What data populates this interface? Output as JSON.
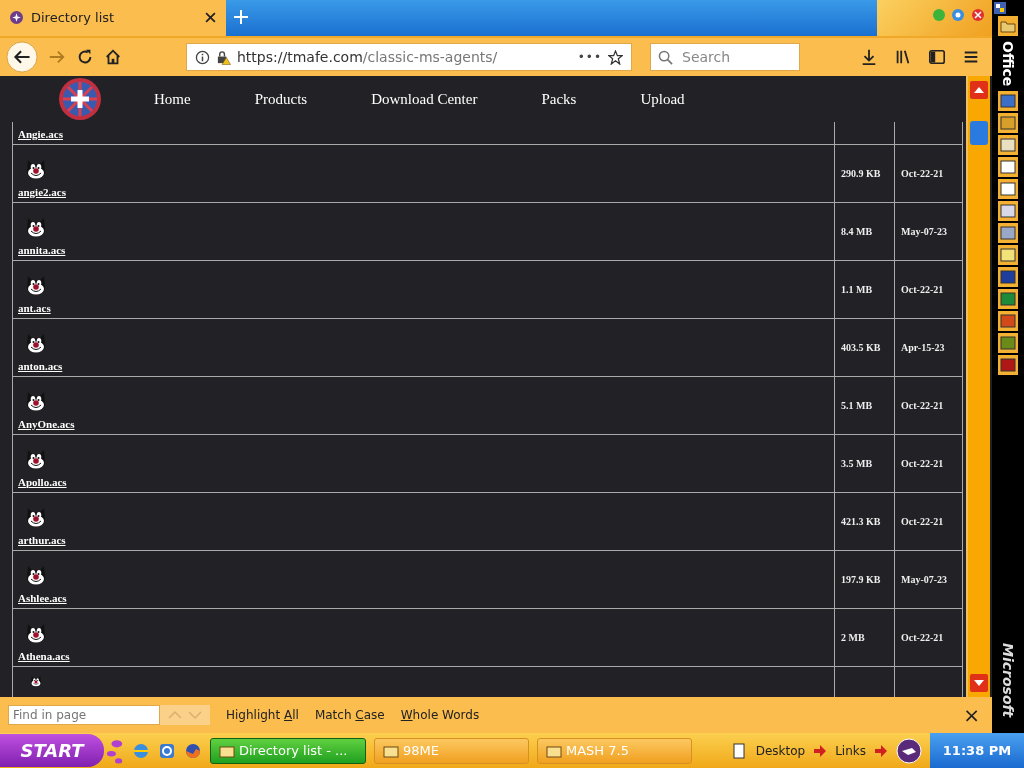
{
  "browser": {
    "tab": {
      "title": "Directory list"
    },
    "url_origin": "https://tmafe.com",
    "url_path": "/classic-ms-agents/",
    "more": "•••",
    "search_placeholder": "Search"
  },
  "site_nav": [
    "Home",
    "Products",
    "Download Center",
    "Packs",
    "Upload"
  ],
  "files": [
    {
      "name": "Angie.acs",
      "kind": "top-cut"
    },
    {
      "name": "angie2.acs",
      "size": "290.9 KB",
      "date": "Oct-22-21",
      "kind": "full"
    },
    {
      "name": "annita.acs",
      "size": "8.4 MB",
      "date": "May-07-23",
      "kind": "full"
    },
    {
      "name": "ant.acs",
      "size": "1.1 MB",
      "date": "Oct-22-21",
      "kind": "full"
    },
    {
      "name": "anton.acs",
      "size": "403.5 KB",
      "date": "Apr-15-23",
      "kind": "full"
    },
    {
      "name": "AnyOne.acs",
      "size": "5.1 MB",
      "date": "Oct-22-21",
      "kind": "full"
    },
    {
      "name": "Apollo.acs",
      "size": "3.5 MB",
      "date": "Oct-22-21",
      "kind": "full"
    },
    {
      "name": "arthur.acs",
      "size": "421.3 KB",
      "date": "Oct-22-21",
      "kind": "full"
    },
    {
      "name": "Ashlee.acs",
      "size": "197.9 KB",
      "date": "May-07-23",
      "kind": "full"
    },
    {
      "name": "Athena.acs",
      "size": "2 MB",
      "date": "Oct-22-21",
      "kind": "full"
    },
    {
      "kind": "bottom-cut"
    }
  ],
  "find_bar": {
    "placeholder": "Find in page",
    "options": [
      {
        "before": "Highlight ",
        "key": "A",
        "after": "ll"
      },
      {
        "before": "Match ",
        "key": "C",
        "after": "ase"
      },
      {
        "key": "W",
        "after": "hole Words"
      }
    ],
    "close": "×"
  },
  "office_bar": {
    "top_label": "Office",
    "bottom_label": "Microsoft"
  },
  "taskbar": {
    "start": "START",
    "tasks": [
      {
        "label": "Directory list - ...",
        "selected": true
      },
      {
        "label": "98ME",
        "selected": false
      },
      {
        "label": "MASH 7.5",
        "selected": false
      }
    ],
    "links": [
      "Desktop",
      "Links"
    ],
    "clock": "11:38 PM"
  }
}
